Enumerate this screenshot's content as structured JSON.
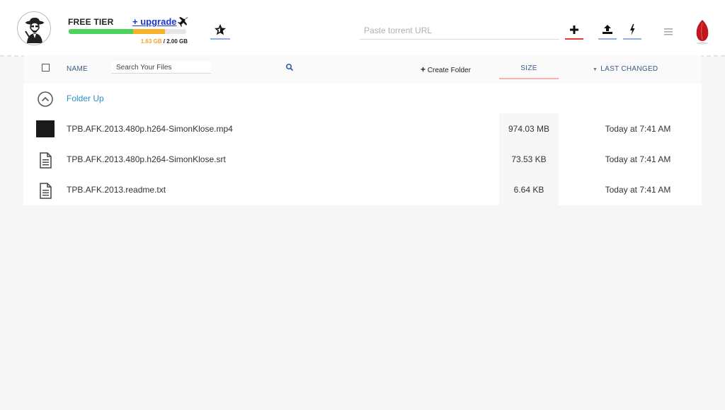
{
  "topbar": {
    "tier_label": "FREE TIER",
    "upgrade_label": "+ upgrade",
    "usage": {
      "used": "1.63 GB",
      "separator": " / ",
      "total": "2.00 GB",
      "used_fraction": 0.815
    },
    "url_placeholder": "Paste torrent URL",
    "accent_red": "#e53935",
    "accent_blue": "#8fb0e6"
  },
  "toolbar": {
    "create_folder_label": "Create Folder",
    "search_placeholder": "Search Your Files"
  },
  "columns": {
    "name": "NAME",
    "size": "SIZE",
    "changed": "LAST CHANGED"
  },
  "folder_up_label": "Folder Up",
  "files": [
    {
      "name": "TPB.AFK.2013.480p.h264-SimonKlose.mp4",
      "size": "974.03 MB",
      "changed": "Today at 7:41 AM",
      "icon": "video-thumbnail"
    },
    {
      "name": "TPB.AFK.2013.480p.h264-SimonKlose.srt",
      "size": "73.53 KB",
      "changed": "Today at 7:41 AM",
      "icon": "document-icon"
    },
    {
      "name": "TPB.AFK.2013.readme.txt",
      "size": "6.64 KB",
      "changed": "Today at 7:41 AM",
      "icon": "document-icon"
    }
  ]
}
